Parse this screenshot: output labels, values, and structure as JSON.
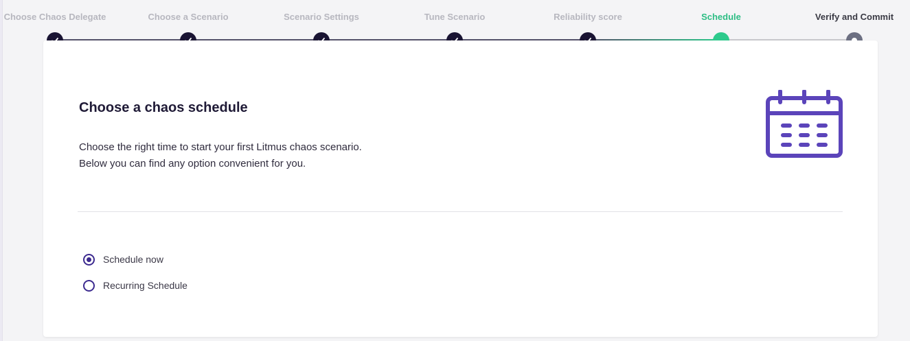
{
  "stepper": {
    "steps": [
      {
        "label": "Choose Chaos Delegate",
        "state": "done"
      },
      {
        "label": "Choose a Scenario",
        "state": "done"
      },
      {
        "label": "Scenario Settings",
        "state": "done"
      },
      {
        "label": "Tune Scenario",
        "state": "done"
      },
      {
        "label": "Reliability score",
        "state": "done"
      },
      {
        "label": "Schedule",
        "state": "active"
      },
      {
        "label": "Verify and Commit",
        "state": "pending"
      }
    ],
    "colors": {
      "done": "#1a1433",
      "active": "#2dca8c",
      "pending": "#6c6f82",
      "line_done": "#55526a",
      "line_pending": "#c8c8cc"
    }
  },
  "main": {
    "title": "Choose a chaos schedule",
    "description_line1": "Choose the right time to start your first Litmus chaos scenario.",
    "description_line2": "Below you can find any option convenient for you.",
    "icon": "calendar-icon",
    "accent_color": "#5b44ba"
  },
  "schedule_options": [
    {
      "label": "Schedule now",
      "selected": true
    },
    {
      "label": "Recurring Schedule",
      "selected": false
    }
  ]
}
